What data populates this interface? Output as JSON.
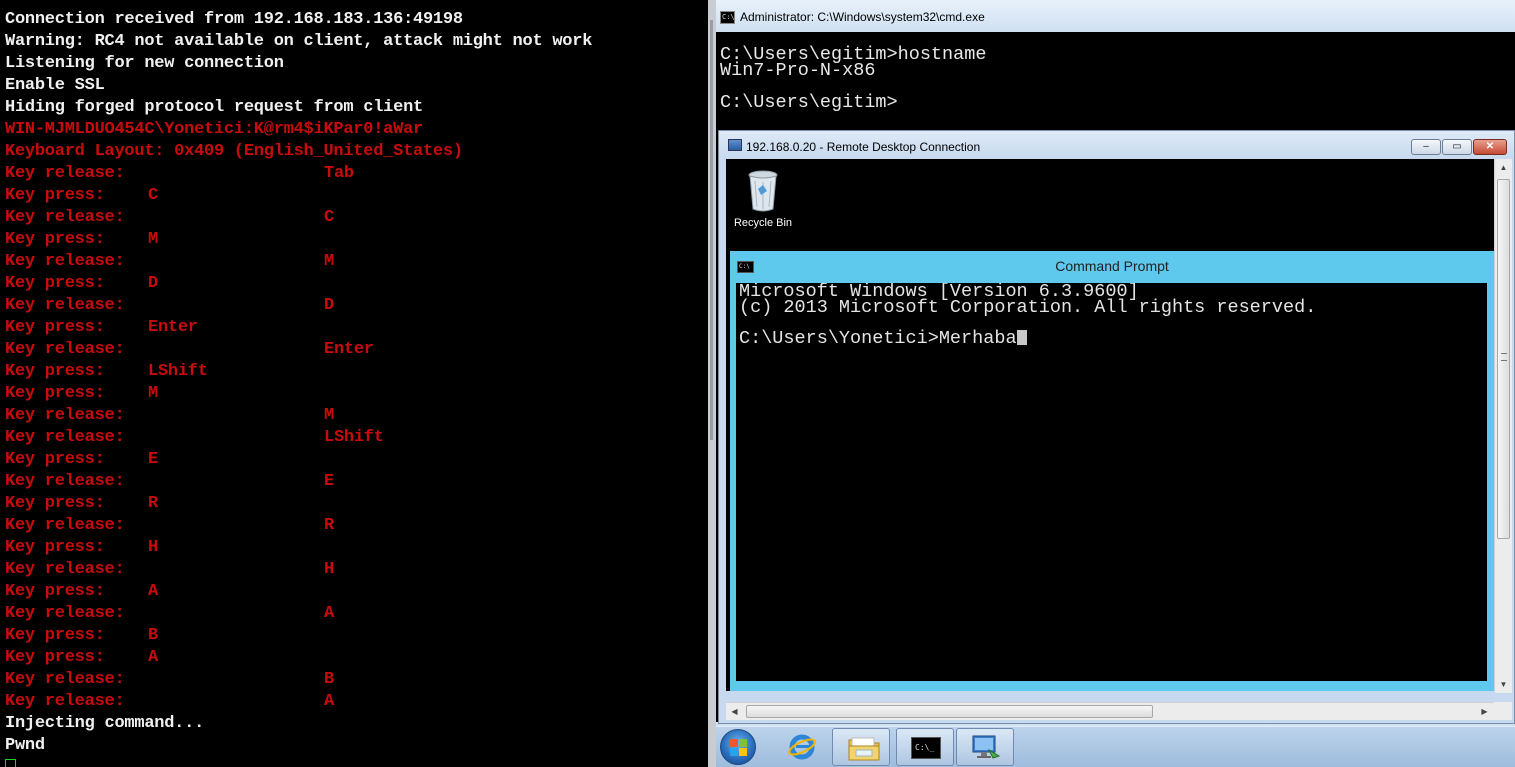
{
  "left_terminal": {
    "lines": [
      {
        "color": "white",
        "c1": "Connection received from 192.168.183.136:49198",
        "c2": "",
        "c3": ""
      },
      {
        "color": "white",
        "c1": "Warning: RC4 not available on client, attack might not work",
        "c2": "",
        "c3": ""
      },
      {
        "color": "white",
        "c1": "Listening for new connection",
        "c2": "",
        "c3": ""
      },
      {
        "color": "white",
        "c1": "Enable SSL",
        "c2": "",
        "c3": ""
      },
      {
        "color": "white",
        "c1": "Hiding forged protocol request from client",
        "c2": "",
        "c3": ""
      },
      {
        "color": "red",
        "c1": "WIN-MJMLDUO454C\\Yonetici:K@rm4$iKPar0!aWar",
        "c2": "",
        "c3": ""
      },
      {
        "color": "red",
        "c1": "Keyboard Layout: 0x409 (English_United_States)",
        "c2": "",
        "c3": ""
      },
      {
        "color": "red",
        "c1": "Key release:",
        "c2": "",
        "c3": "Tab"
      },
      {
        "color": "red",
        "c1": "Key press:",
        "c2": "C",
        "c3": ""
      },
      {
        "color": "red",
        "c1": "Key release:",
        "c2": "",
        "c3": "C"
      },
      {
        "color": "red",
        "c1": "Key press:",
        "c2": "M",
        "c3": ""
      },
      {
        "color": "red",
        "c1": "Key release:",
        "c2": "",
        "c3": "M"
      },
      {
        "color": "red",
        "c1": "Key press:",
        "c2": "D",
        "c3": ""
      },
      {
        "color": "red",
        "c1": "Key release:",
        "c2": "",
        "c3": "D"
      },
      {
        "color": "red",
        "c1": "Key press:",
        "c2": "Enter",
        "c3": ""
      },
      {
        "color": "red",
        "c1": "Key release:",
        "c2": "",
        "c3": "Enter"
      },
      {
        "color": "red",
        "c1": "Key press:",
        "c2": "LShift",
        "c3": ""
      },
      {
        "color": "red",
        "c1": "Key press:",
        "c2": "M",
        "c3": ""
      },
      {
        "color": "red",
        "c1": "Key release:",
        "c2": "",
        "c3": "M"
      },
      {
        "color": "red",
        "c1": "Key release:",
        "c2": "",
        "c3": "LShift"
      },
      {
        "color": "red",
        "c1": "Key press:",
        "c2": "E",
        "c3": ""
      },
      {
        "color": "red",
        "c1": "Key release:",
        "c2": "",
        "c3": "E"
      },
      {
        "color": "red",
        "c1": "Key press:",
        "c2": "R",
        "c3": ""
      },
      {
        "color": "red",
        "c1": "Key release:",
        "c2": "",
        "c3": "R"
      },
      {
        "color": "red",
        "c1": "Key press:",
        "c2": "H",
        "c3": ""
      },
      {
        "color": "red",
        "c1": "Key release:",
        "c2": "",
        "c3": "H"
      },
      {
        "color": "red",
        "c1": "Key press:",
        "c2": "A",
        "c3": ""
      },
      {
        "color": "red",
        "c1": "Key release:",
        "c2": "",
        "c3": "A"
      },
      {
        "color": "red",
        "c1": "Key press:",
        "c2": "B",
        "c3": ""
      },
      {
        "color": "red",
        "c1": "Key press:",
        "c2": "A",
        "c3": ""
      },
      {
        "color": "red",
        "c1": "Key release:",
        "c2": "",
        "c3": "B"
      },
      {
        "color": "red",
        "c1": "Key release:",
        "c2": "",
        "c3": "A"
      },
      {
        "color": "white",
        "c1": "Injecting command...",
        "c2": "",
        "c3": ""
      },
      {
        "color": "white",
        "c1": "Pwnd",
        "c2": "",
        "c3": ""
      }
    ]
  },
  "admin_window": {
    "title": "Administrator: C:\\Windows\\system32\\cmd.exe",
    "icon_text": "C:\\",
    "console": [
      "C:\\Users\\egitim>hostname",
      "Win7-Pro-N-x86",
      "C:\\Users\\egitim>"
    ]
  },
  "rdp_window": {
    "title": "192.168.0.20 - Remote Desktop Connection",
    "min_glyph": "–",
    "max_glyph": "▭",
    "close_glyph": "✕",
    "desktop": {
      "recycle_bin_label": "Recycle Bin"
    },
    "inner_cmd": {
      "title": "Command Prompt",
      "icon_text": "C:\\",
      "console": [
        "Microsoft Windows [Version 6.3.9600]",
        "(c) 2013 Microsoft Corporation. All rights reserved.",
        "C:\\Users\\Yonetici>Merhaba"
      ]
    },
    "scroll": {
      "up": "▲",
      "down": "▼",
      "left": "◀",
      "right": "▶"
    }
  },
  "taskbar": {
    "cmd_icon_text": "C:\\_"
  },
  "colors": {
    "terminal_white": "#f0f0f0",
    "terminal_red": "#c80c0c",
    "win8_title_cyan": "#5ec8ed",
    "aero_blue": "#c6d9ee"
  }
}
